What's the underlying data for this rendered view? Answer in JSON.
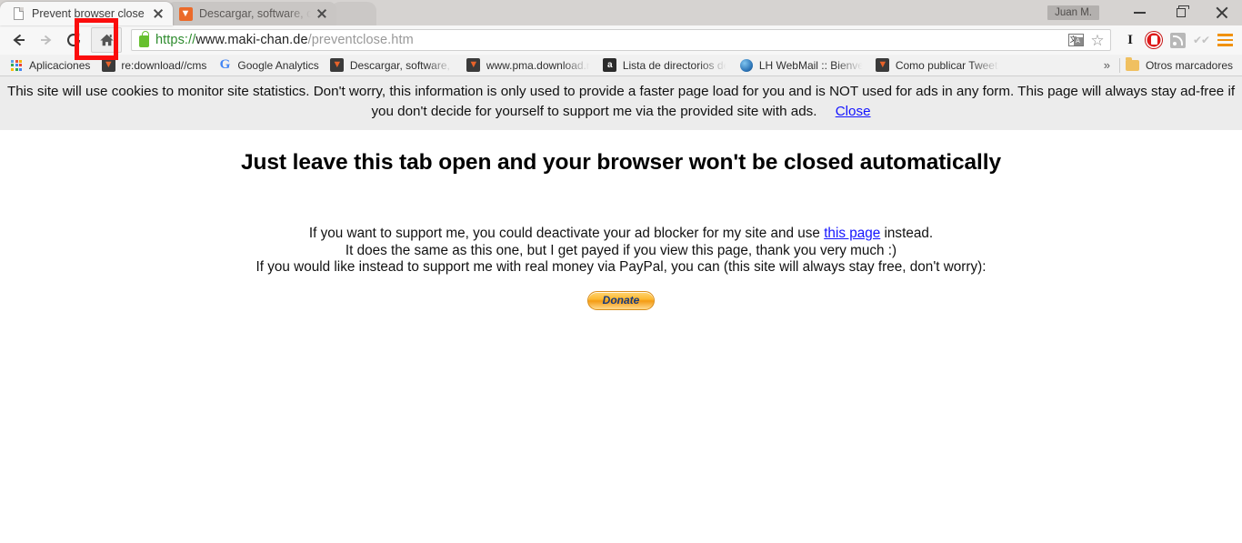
{
  "window": {
    "profile_name": "Juan M.",
    "minimize_label": "Minimize",
    "maximize_label": "Restore",
    "close_label": "Close"
  },
  "tabs": [
    {
      "title": "Prevent browser close tab",
      "favicon": "document-icon",
      "active": true
    },
    {
      "title": "Descargar, software, contr",
      "favicon": "download-orange-icon",
      "active": false
    }
  ],
  "newtab": {
    "label": ""
  },
  "toolbar": {
    "back_label": "Back",
    "forward_label": "Forward",
    "reload_label": "Reload",
    "home_label": "Home",
    "url": {
      "scheme": "https://",
      "host": "www.maki-chan.de",
      "path": "/preventclose.htm"
    },
    "security_label": "Secure",
    "translate_label": "Translate this page",
    "bookmark_label": "Bookmark this page",
    "extensions": [
      {
        "name": "italic-i-icon",
        "glyph": "I"
      },
      {
        "name": "adblock-icon",
        "glyph": ""
      },
      {
        "name": "rss-feed-icon",
        "glyph": ""
      },
      {
        "name": "double-check-icon",
        "glyph": "✔✔"
      },
      {
        "name": "chrome-menu-icon",
        "glyph": ""
      }
    ]
  },
  "bookmarks": {
    "items": [
      {
        "label": "Aplicaciones",
        "icon": "apps-grid-icon",
        "truncated": false
      },
      {
        "label": "re:download//cms",
        "icon": "download-orange-icon",
        "truncated": false
      },
      {
        "label": "Google Analytics",
        "icon": "google-g-icon",
        "truncated": false
      },
      {
        "label": "Descargar, software, c",
        "icon": "download-orange-icon",
        "truncated": true
      },
      {
        "label": "www.pma.download.n",
        "icon": "download-orange-icon",
        "truncated": true
      },
      {
        "label": "Lista de directorios de",
        "icon": "apache-a-icon",
        "truncated": true
      },
      {
        "label": "LH WebMail :: Bienver",
        "icon": "globe-blue-icon",
        "truncated": true
      },
      {
        "label": "Como publicar Tweets",
        "icon": "download-orange-icon",
        "truncated": true
      }
    ],
    "overflow_label": "»",
    "other_bookmarks_label": "Otros marcadores",
    "other_bookmarks_icon": "folder-icon"
  },
  "cookie_notice": {
    "text": "This site will use cookies to monitor site statistics. Don't worry, this information is only used to provide a faster page load for you and is NOT used for ads in any form. This page will always stay ad-free if you don't decide for yourself to support me via the provided site with ads.",
    "close_label": "Close"
  },
  "content": {
    "headline": "Just leave this tab open and your browser won't be closed automatically",
    "line1_before": "If you want to support me, you could deactivate your ad blocker for my site and use ",
    "line1_link": "this page",
    "line1_after": " instead.",
    "line2": "It does the same as this one, but I get payed if you view this page, thank you very much :)",
    "line3": "If you would like instead to support me with real money via PayPal, you can (this site will always stay free, don't worry):",
    "donate_label": "Donate"
  },
  "annotation": {
    "target": "home-button",
    "color": "#fb0d0d"
  }
}
